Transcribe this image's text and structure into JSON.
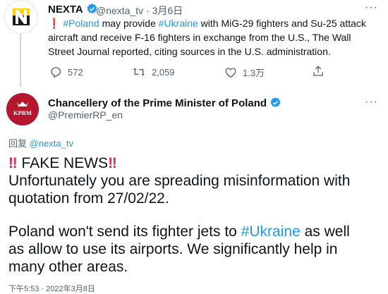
{
  "tweet1": {
    "name": "NEXTA",
    "handle_time": "@nexta_tv · 3月6日",
    "excl": "❗",
    "tag1": "#Poland",
    "text_a": " may provide ",
    "tag2": "#Ukraine",
    "text_b": " with MiG-29 fighters and Su-25 attack aircraft and receive F-16 fighters in exchange from the U.S., The Wall Street Journal reported, citing sources in the U.S. administration.",
    "replies": "572",
    "retweets": "2,059",
    "likes": "1.3万"
  },
  "tweet2": {
    "name": "Chancellery of the Prime Minister of Poland",
    "handle": "@PremierRP_en",
    "avatar_text": "KPRM",
    "reply_prefix": "回复 ",
    "reply_handle": "@nexta_tv",
    "excl": "‼",
    "line1": "FAKE NEWS",
    "line2": "Unfortunately you are spreading misinformation with",
    "line3": "quotation from 27/02/22.",
    "line4a": "Poland won't send its fighter jets to ",
    "line4_tag": "#Ukraine",
    "line4b": " as well",
    "line5": "as allow to use its airports. We significantly help in",
    "line6": "many other areas.",
    "cut": "下午5:53 · 2022年3月8日"
  }
}
